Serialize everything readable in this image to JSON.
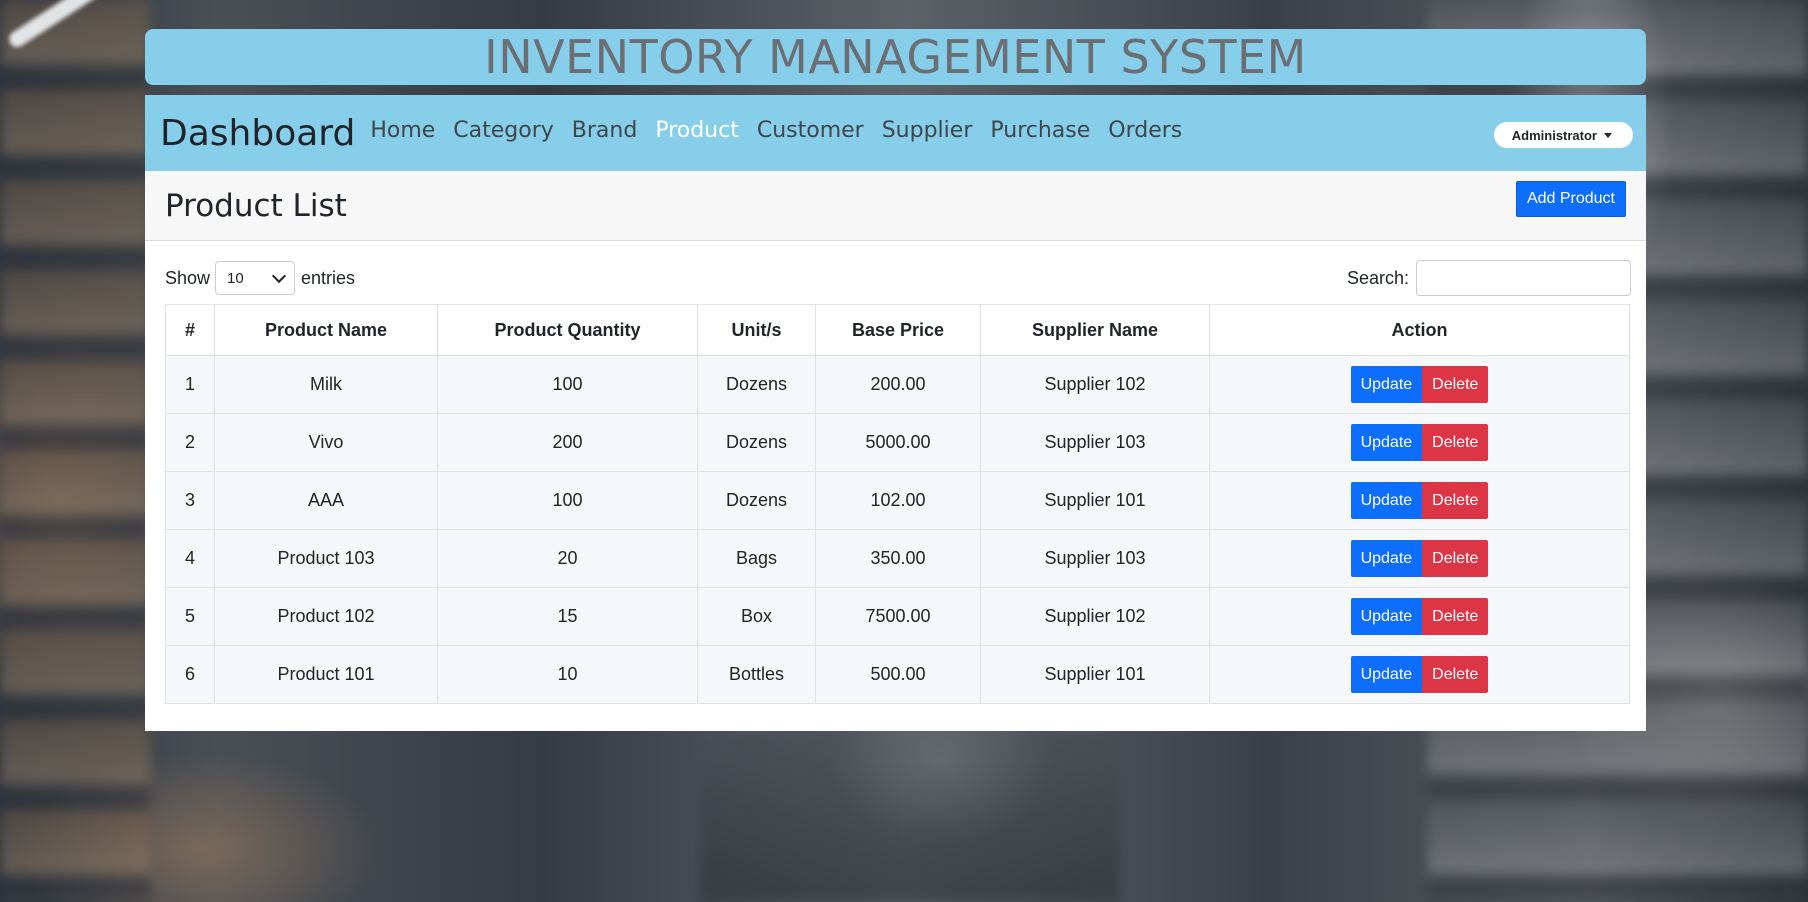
{
  "app_title": "INVENTORY MANAGEMENT SYSTEM",
  "navbar": {
    "brand": "Dashboard",
    "links": [
      {
        "label": "Home",
        "active": false
      },
      {
        "label": "Category",
        "active": false
      },
      {
        "label": "Brand",
        "active": false
      },
      {
        "label": "Product",
        "active": true
      },
      {
        "label": "Customer",
        "active": false
      },
      {
        "label": "Supplier",
        "active": false
      },
      {
        "label": "Purchase",
        "active": false
      },
      {
        "label": "Orders",
        "active": false
      }
    ],
    "user_menu": "Administrator"
  },
  "page": {
    "heading": "Product List",
    "add_button": "Add Product"
  },
  "table_controls": {
    "show_label": "Show",
    "page_length": "10",
    "entries_label": "entries",
    "search_label": "Search:",
    "search_value": ""
  },
  "table": {
    "headers": [
      "#",
      "Product Name",
      "Product Quantity",
      "Unit/s",
      "Base Price",
      "Supplier Name",
      "Action"
    ],
    "rows": [
      [
        "1",
        "Milk",
        "100",
        "Dozens",
        "200.00",
        "Supplier 102"
      ],
      [
        "2",
        "Vivo",
        "200",
        "Dozens",
        "5000.00",
        "Supplier 103"
      ],
      [
        "3",
        "AAA",
        "100",
        "Dozens",
        "102.00",
        "Supplier 101"
      ],
      [
        "4",
        "Product 103",
        "20",
        "Bags",
        "350.00",
        "Supplier 103"
      ],
      [
        "5",
        "Product 102",
        "15",
        "Box",
        "7500.00",
        "Supplier 102"
      ],
      [
        "6",
        "Product 101",
        "10",
        "Bottles",
        "500.00",
        "Supplier 101"
      ]
    ],
    "update_label": "Update",
    "delete_label": "Delete"
  },
  "colors": {
    "header_bg": "#87ceeb",
    "primary": "#0d6efd",
    "danger": "#dc3545",
    "active_nav": "#ffffff"
  }
}
